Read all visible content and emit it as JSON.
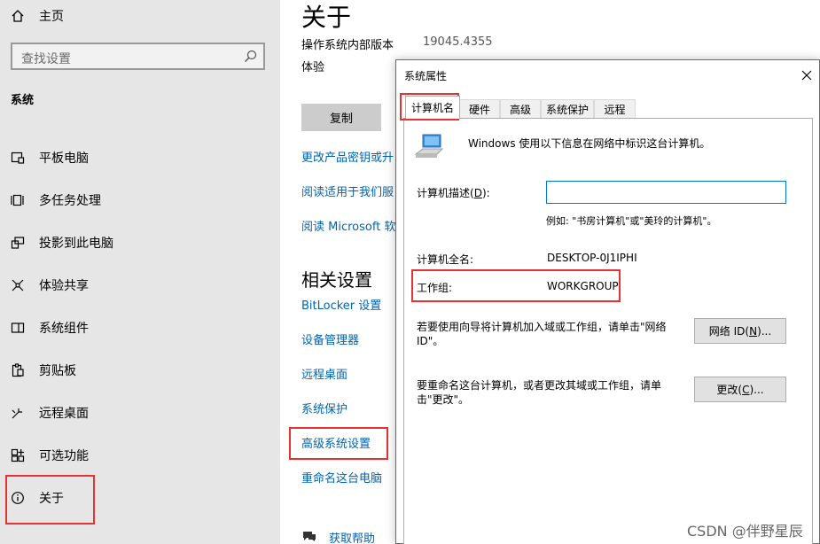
{
  "sidebar": {
    "home_label": "主页",
    "search_placeholder": "查找设置",
    "section_heading": "系统",
    "items": [
      {
        "label": "平板电脑",
        "icon": "tablet-icon"
      },
      {
        "label": "多任务处理",
        "icon": "multitasking-icon"
      },
      {
        "label": "投影到此电脑",
        "icon": "project-icon"
      },
      {
        "label": "体验共享",
        "icon": "shared-experience-icon"
      },
      {
        "label": "系统组件",
        "icon": "system-components-icon"
      },
      {
        "label": "剪贴板",
        "icon": "clipboard-icon"
      },
      {
        "label": "远程桌面",
        "icon": "remote-desktop-icon"
      },
      {
        "label": "可选功能",
        "icon": "optional-features-icon"
      },
      {
        "label": "关于",
        "icon": "info-icon"
      }
    ]
  },
  "main": {
    "title": "关于",
    "build_label": "操作系统内部版本",
    "build_value": "19045.4355",
    "experience_label": "体验",
    "copy_button": "复制",
    "links": [
      "更改产品密钥或升",
      "阅读适用于我们服",
      "阅读 Microsoft 软"
    ],
    "related_heading": "相关设置",
    "related_links": [
      "BitLocker 设置",
      "设备管理器",
      "远程桌面",
      "系统保护",
      "高级系统设置",
      "重命名这台电脑"
    ],
    "help_link": "获取帮助"
  },
  "dialog": {
    "title": "系统属性",
    "tabs": [
      "计算机名",
      "硬件",
      "高级",
      "系统保护",
      "远程"
    ],
    "active_tab": "计算机名",
    "intro": "Windows 使用以下信息在网络中标识这台计算机。",
    "desc_label_prefix": "计算机描述(",
    "desc_label_key": "D",
    "desc_label_suffix": "):",
    "desc_value": "",
    "example": "例如: \"书房计算机\"或\"美玲的计算机\"。",
    "fullname_label": "计算机全名:",
    "fullname_value": "DESKTOP-0J1IPHI",
    "workgroup_label": "工作组:",
    "workgroup_value": "WORKGROUP",
    "network_text": "若要使用向导将计算机加入域或工作组，请单击\"网络 ID\"。",
    "network_button_prefix": "网络 ID(",
    "network_button_key": "N",
    "network_button_suffix": ")...",
    "change_text": "要重命名这台计算机，或者更改其域或工作组，请单击\"更改\"。",
    "change_button_prefix": "更改(",
    "change_button_key": "C",
    "change_button_suffix": ")..."
  },
  "watermark": "CSDN @伴野星辰",
  "colors": {
    "link": "#0063b1",
    "highlight": "#e53333",
    "sidebar_bg": "#e6e6e6"
  }
}
